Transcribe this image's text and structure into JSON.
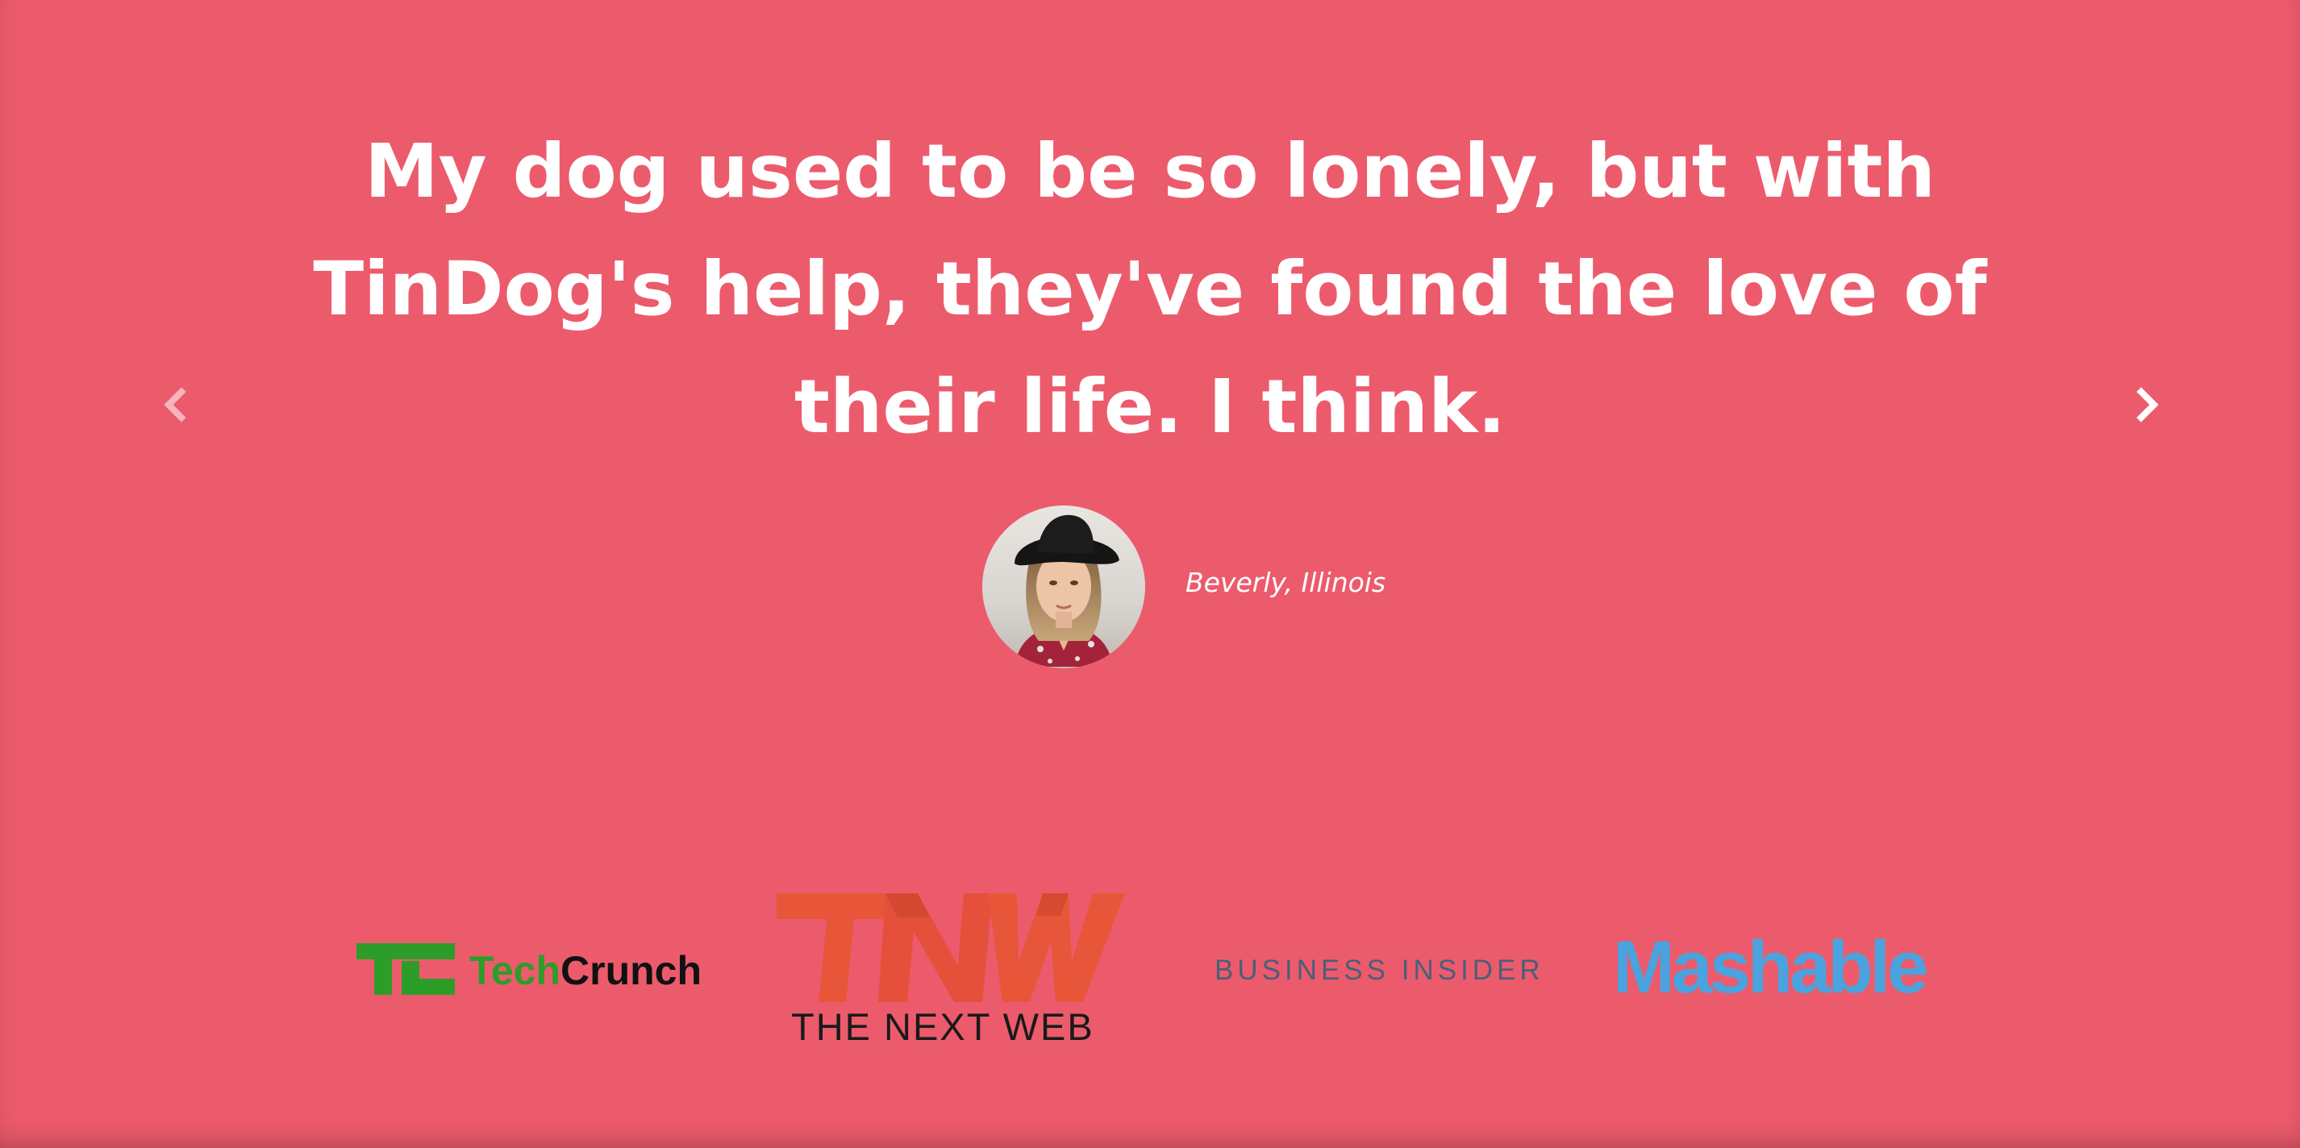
{
  "testimonial": {
    "quote": "My dog used to be so lonely, but with TinDog's help, they've found the love of their life. I think.",
    "author": "Beverly, Illinois"
  },
  "carousel": {
    "prev_icon": "chevron-left-icon",
    "next_icon": "chevron-right-icon"
  },
  "press": {
    "techcrunch": {
      "tech": "Tech",
      "crunch": "Crunch"
    },
    "tnw": {
      "subtitle": "THE NEXT WEB",
      "mark": "TNW"
    },
    "business_insider": "BUSINESS INSIDER",
    "mashable": "Mashable"
  },
  "colors": {
    "background": "#ec5b6c",
    "techcrunch_green": "#2d9d2a",
    "tnw_orange": "#e8563a",
    "mashable_blue": "#4aa3df",
    "business_insider_gray": "#4a5f7a"
  }
}
